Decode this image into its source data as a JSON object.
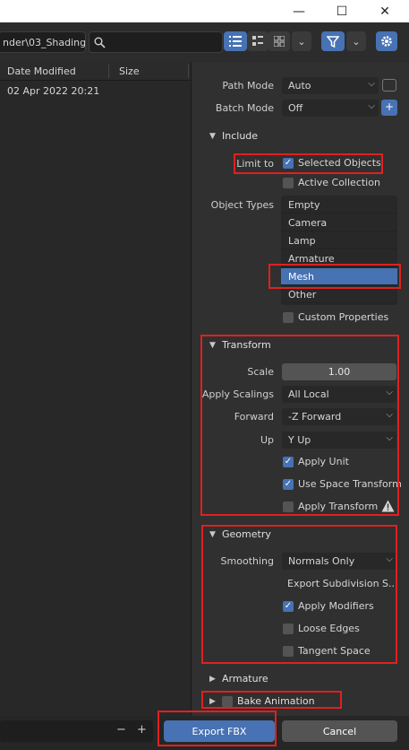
{
  "window": {
    "minimize": "—",
    "maximize": "☐",
    "close": "✕"
  },
  "toolbar": {
    "path": "nder\\03_Shading\\",
    "search_placeholder": "",
    "view_icons": [
      "list-view-icon",
      "thumbnail-small-icon",
      "thumbnail-large-icon"
    ],
    "dropdown_chevron": "⌄"
  },
  "filelist": {
    "columns": [
      "Date Modified",
      "Size"
    ],
    "rows": [
      {
        "date": "02 Apr 2022 20:21"
      }
    ]
  },
  "settings": {
    "path_mode": {
      "label": "Path Mode",
      "value": "Auto"
    },
    "batch_mode": {
      "label": "Batch Mode",
      "value": "Off"
    },
    "include": {
      "title": "Include",
      "limit_to_label": "Limit to",
      "selected_objects": "Selected Objects",
      "active_collection": "Active Collection",
      "object_types_label": "Object Types",
      "object_types": [
        "Empty",
        "Camera",
        "Lamp",
        "Armature",
        "Mesh",
        "Other"
      ],
      "object_types_selected": "Mesh",
      "custom_properties": "Custom Properties"
    },
    "transform": {
      "title": "Transform",
      "scale_label": "Scale",
      "scale_value": "1.00",
      "apply_scalings_label": "Apply Scalings",
      "apply_scalings_value": "All Local",
      "forward_label": "Forward",
      "forward_value": "-Z Forward",
      "up_label": "Up",
      "up_value": "Y Up",
      "apply_unit": "Apply Unit",
      "use_space_transform": "Use Space Transform",
      "apply_transform": "Apply Transform"
    },
    "geometry": {
      "title": "Geometry",
      "smoothing_label": "Smoothing",
      "smoothing_value": "Normals Only",
      "export_subdivision": "Export Subdivision S...",
      "apply_modifiers": "Apply Modifiers",
      "loose_edges": "Loose Edges",
      "tangent_space": "Tangent Space"
    },
    "armature": {
      "title": "Armature"
    },
    "bake_animation": {
      "title": "Bake Animation"
    }
  },
  "bottom": {
    "minus": "−",
    "plus": "+",
    "export_label": "Export FBX",
    "cancel_label": "Cancel"
  },
  "colors": {
    "accent": "#4772b3",
    "annotation": "#e02020"
  }
}
